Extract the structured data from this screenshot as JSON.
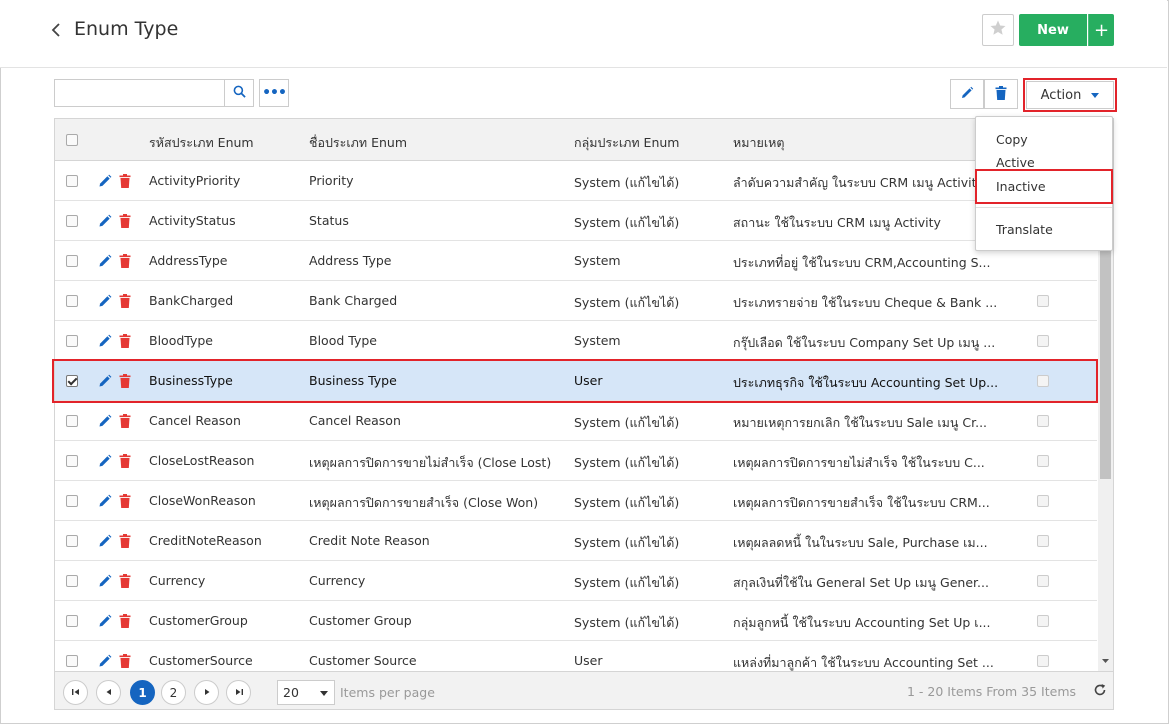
{
  "header": {
    "title": "Enum Type",
    "new_label": "New",
    "plus_label": "+"
  },
  "toolbar": {
    "search_value": "",
    "more_label": "•••",
    "action_label": "Action"
  },
  "columns": [
    "รหัสประเภท Enum",
    "ชื่อประเภท Enum",
    "กลุ่มประเภท Enum",
    "หมายเหตุ"
  ],
  "rows": [
    {
      "code": "ActivityPriority",
      "name": "Priority",
      "group": "System (แก้ไขได้)",
      "remark": "ลำดับความสำคัญ ในระบบ CRM เมนู Activity",
      "selected": false
    },
    {
      "code": "ActivityStatus",
      "name": "Status",
      "group": "System (แก้ไขได้)",
      "remark": "สถานะ ใช้ในระบบ CRM เมนู Activity",
      "selected": false
    },
    {
      "code": "AddressType",
      "name": "Address Type",
      "group": "System",
      "remark": "ประเภทที่อยู่ ใช้ในระบบ CRM,Accounting S...",
      "selected": false
    },
    {
      "code": "BankCharged",
      "name": "Bank Charged",
      "group": "System (แก้ไขได้)",
      "remark": "ประเภทรายจ่าย ใช้ในระบบ Cheque & Bank ...",
      "selected": false
    },
    {
      "code": "BloodType",
      "name": "Blood Type",
      "group": "System",
      "remark": "กรุ๊ปเลือด ใช้ในระบบ Company Set Up เมนู ...",
      "selected": false
    },
    {
      "code": "BusinessType",
      "name": "Business Type",
      "group": "User",
      "remark": "ประเภทธุรกิจ ใช้ในระบบ Accounting Set Up...",
      "selected": true
    },
    {
      "code": "Cancel Reason",
      "name": "Cancel Reason",
      "group": "System (แก้ไขได้)",
      "remark": "หมายเหตุการยกเลิก ใช้ในระบบ Sale เมนู Cr...",
      "selected": false
    },
    {
      "code": "CloseLostReason",
      "name": "เหตุผลการปิดการขายไม่สำเร็จ (Close Lost)",
      "group": "System (แก้ไขได้)",
      "remark": "เหตุผลการปิดการขายไม่สำเร็จ ใช้ในระบบ C...",
      "selected": false
    },
    {
      "code": "CloseWonReason",
      "name": "เหตุผลการปิดการขายสำเร็จ (Close Won)",
      "group": "System (แก้ไขได้)",
      "remark": "เหตุผลการปิดการขายสำเร็จ ใช้ในระบบ CRM...",
      "selected": false
    },
    {
      "code": "CreditNoteReason",
      "name": "Credit Note Reason",
      "group": "System (แก้ไขได้)",
      "remark": "เหตุผลลดหนี้ ในในระบบ Sale, Purchase เม...",
      "selected": false
    },
    {
      "code": "Currency",
      "name": "Currency",
      "group": "System (แก้ไขได้)",
      "remark": "สกุลเงินที่ใช้ใน General Set Up เมนู Gener...",
      "selected": false
    },
    {
      "code": "CustomerGroup",
      "name": "Customer Group",
      "group": "System (แก้ไขได้)",
      "remark": "กลุ่มลูกหนี้ ใช้ในระบบ Accounting Set Up เ...",
      "selected": false
    },
    {
      "code": "CustomerSource",
      "name": "Customer Source",
      "group": "User",
      "remark": "แหล่งที่มาลูกค้า ใช้ในระบบ Accounting Set ...",
      "selected": false
    }
  ],
  "action_menu": {
    "items": [
      "Copy",
      "Active",
      "Inactive",
      "Translate"
    ]
  },
  "pager": {
    "pages": [
      "1",
      "2"
    ],
    "current_page": "1",
    "page_size": "20",
    "per_page_label": "Items per page",
    "info": "1 - 20 Items From 35 Items"
  },
  "colors": {
    "accent": "#1565c0",
    "primary_green": "#27ae60",
    "delete_red": "#e53935",
    "highlight_red": "#e2232a",
    "selected_row": "#d6e6f8"
  }
}
